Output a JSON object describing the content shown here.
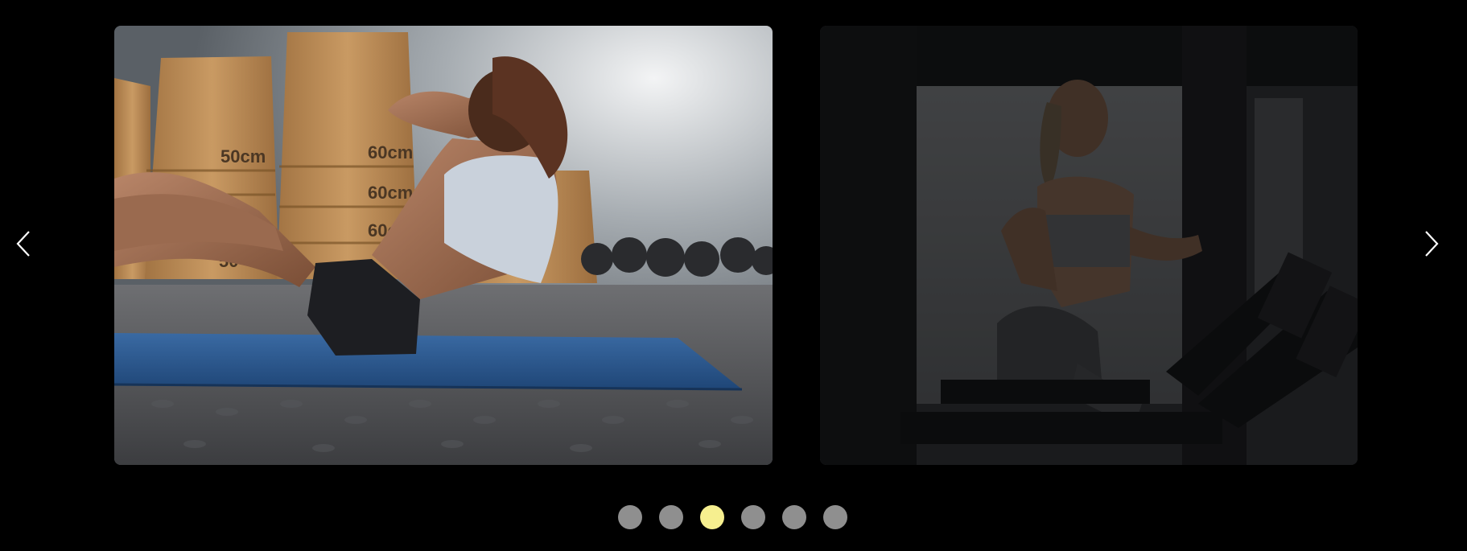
{
  "carousel": {
    "prev_icon": "chevron-left-icon",
    "next_icon": "chevron-right-icon",
    "slides": [
      {
        "label": "slide-situps",
        "box_labels": [
          "50cm",
          "60cm",
          "60cm",
          "60cm",
          "50"
        ]
      },
      {
        "label": "slide-treadmill"
      }
    ],
    "dots": {
      "count": 6,
      "active_index": 2
    },
    "colors": {
      "background": "#000000",
      "dot_inactive": "#8f8f8f",
      "dot_active": "#f6ef8f",
      "mat": "#2a5b92",
      "boxes": "#b98a52"
    }
  }
}
